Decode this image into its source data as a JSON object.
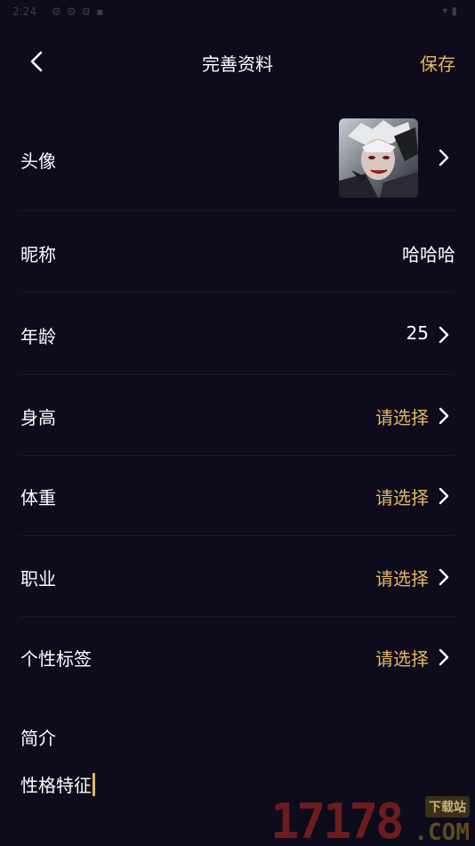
{
  "status_bar": {
    "time": "2:24"
  },
  "header": {
    "title": "完善资料",
    "save_label": "保存"
  },
  "rows": [
    {
      "label": "头像"
    },
    {
      "label": "昵称",
      "value": "哈哈哈"
    },
    {
      "label": "年龄",
      "value": "25"
    },
    {
      "label": "身高",
      "value": "请选择"
    },
    {
      "label": "体重",
      "value": "请选择"
    },
    {
      "label": "职业",
      "value": "请选择"
    },
    {
      "label": "个性标签",
      "value": "请选择"
    }
  ],
  "bio": {
    "label": "简介",
    "value": "性格特征"
  },
  "watermark": {
    "number": "17178",
    "badge": "下载站",
    "domain": ".COM"
  },
  "colors": {
    "accent": "#e3b764",
    "background": "#0e0b1c"
  },
  "icons": {
    "back": "chevron-left-icon",
    "row_arrow": "chevron-right-icon"
  }
}
